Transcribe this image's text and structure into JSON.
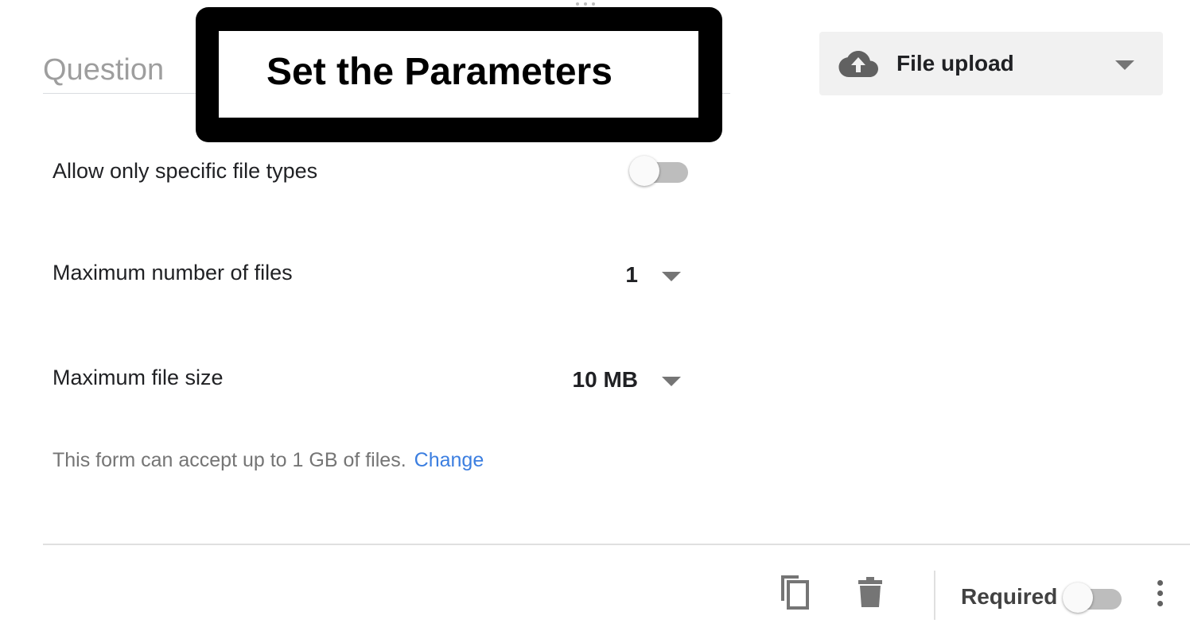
{
  "question": {
    "placeholder": "Question"
  },
  "callout": {
    "text": "Set the Parameters"
  },
  "question_type": {
    "icon": "cloud-upload-icon",
    "label": "File upload"
  },
  "settings": {
    "specific_types": {
      "label": "Allow only specific file types",
      "enabled": false
    },
    "max_files": {
      "label": "Maximum number of files",
      "value": "1"
    },
    "max_size": {
      "label": "Maximum file size",
      "value": "10 MB"
    },
    "note": {
      "text": "This form can accept up to 1 GB of files.",
      "link": "Change"
    }
  },
  "footer": {
    "duplicate_icon": "copy-icon",
    "delete_icon": "trash-icon",
    "required_label": "Required",
    "required_enabled": false,
    "more_icon": "more-vert-icon"
  },
  "colors": {
    "link": "#3b7ee0",
    "panel": "#f1f1f1",
    "toggle_off": "#bdbdbd"
  }
}
